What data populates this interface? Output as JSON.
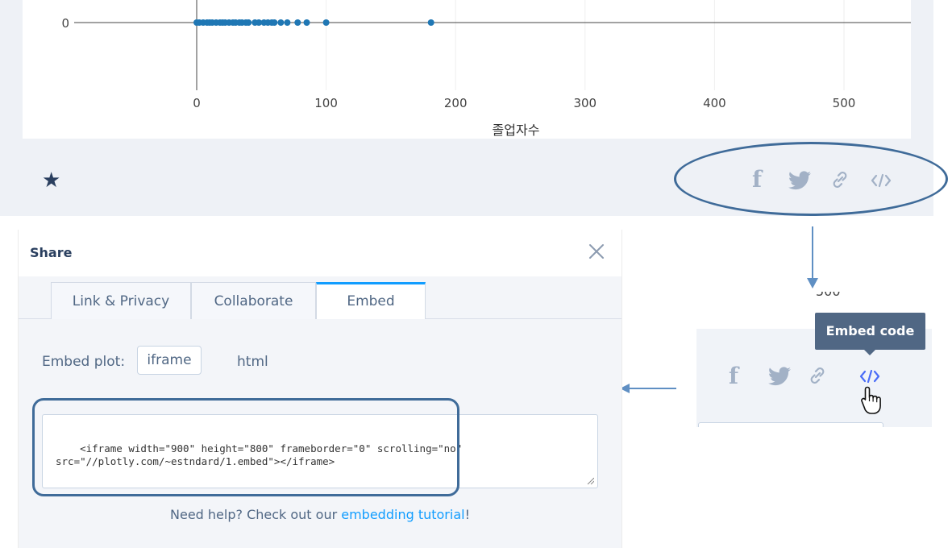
{
  "plot": {
    "x_tick_labels": [
      "0",
      "100",
      "200",
      "300",
      "400",
      "500"
    ],
    "y_tick_labels": [
      "0"
    ],
    "x_axis_title": "졸업자수",
    "marker_color": "#1f77b4"
  },
  "chart_data": {
    "type": "scatter",
    "xlabel": "졸업자수",
    "ylabel": "",
    "xlim": [
      -1,
      550
    ],
    "series": [
      {
        "x": [
          0,
          2,
          5,
          8,
          10,
          12,
          15,
          18,
          20,
          22,
          25,
          28,
          30,
          33,
          35,
          38,
          40,
          45,
          48,
          52,
          55,
          58,
          60,
          65,
          70,
          78,
          85,
          100,
          181
        ],
        "y": [
          0,
          0,
          0,
          0,
          0,
          0,
          0,
          0,
          0,
          0,
          0,
          0,
          0,
          0,
          0,
          0,
          0,
          0,
          0,
          0,
          0,
          0,
          0,
          0,
          0,
          0,
          0,
          0,
          0
        ]
      }
    ]
  },
  "toolbar": {
    "favorite_icon": "star-icon",
    "share_icons": [
      "facebook-icon",
      "twitter-icon",
      "link-icon",
      "embed-code-icon"
    ]
  },
  "dialog": {
    "title": "Share",
    "close_icon": "close-icon",
    "tabs": [
      {
        "label": "Link & Privacy"
      },
      {
        "label": "Collaborate"
      },
      {
        "label": "Embed",
        "active": true
      }
    ],
    "embed_plot_label": "Embed plot:",
    "options": {
      "iframe": "iframe",
      "html": "html"
    },
    "embed_code": "<iframe width=\"900\" height=\"800\" frameborder=\"0\" scrolling=\"no\"\nsrc=\"//plotly.com/~estndard/1.embed\"></iframe>",
    "help_prefix": "Need help? Check out our ",
    "help_link": "embedding tutorial",
    "help_suffix": "!"
  },
  "inset": {
    "tick_fragment": "500",
    "tooltip": "Embed code"
  },
  "colors": {
    "accent": "#119dff",
    "annotation": "#3f6b99",
    "icon_gray": "#a2b1c6",
    "active_icon": "#4a6cf7"
  }
}
